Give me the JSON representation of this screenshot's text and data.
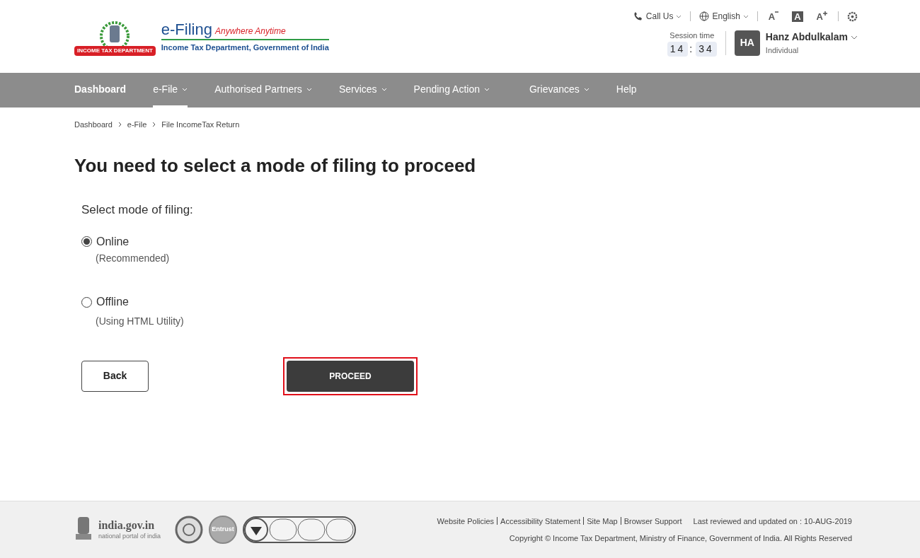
{
  "header": {
    "logo_title": "e-Filing",
    "logo_tagline": "Anywhere Anytime",
    "logo_subtitle": "Income Tax Department, Government of India",
    "emblem_ribbon": "INCOME TAX DEPARTMENT",
    "top_links": [
      {
        "kind": "call",
        "label": "Call Us"
      },
      {
        "kind": "language",
        "label": "English"
      }
    ],
    "text_size_controls": [
      {
        "label": "A",
        "kind": "decrease",
        "selected": false
      },
      {
        "label": "A",
        "kind": "normal",
        "selected": true
      },
      {
        "label": "A",
        "kind": "increase",
        "selected": false
      }
    ],
    "session": {
      "label": "Session time",
      "minutes": "14",
      "separator": ":",
      "seconds": "34"
    },
    "user": {
      "initials": "HA",
      "name": "Hanz Abdulkalam",
      "role": "Individual"
    }
  },
  "nav": [
    {
      "label": "Dashboard",
      "dropdown": false,
      "selected": false
    },
    {
      "label": "e-File",
      "dropdown": true,
      "selected": true
    },
    {
      "label": "Authorised Partners",
      "dropdown": true,
      "selected": false
    },
    {
      "label": "Services",
      "dropdown": true,
      "selected": false
    },
    {
      "label": "Pending Action",
      "dropdown": true,
      "selected": false
    },
    {
      "label": "Grievances",
      "dropdown": true,
      "selected": false
    },
    {
      "label": "Help",
      "dropdown": false,
      "selected": false
    }
  ],
  "breadcrumbs": [
    "Dashboard",
    "e-File",
    "File IncomeTax Return"
  ],
  "heading": "You need to select a mode of filing to proceed",
  "form": {
    "label": "Select mode of filing:",
    "options": [
      {
        "label": "Online",
        "note": "(Recommended)",
        "selected": true
      },
      {
        "label": "Offline",
        "note": "(Using HTML Utility)",
        "selected": false
      }
    ],
    "back_button": "Back",
    "proceed_button": "PROCEED",
    "proceed_highlighted": true
  },
  "footer": {
    "portal_name": "india.gov.in",
    "portal_tagline": "national portal of india",
    "badge_text": "Entrust",
    "links": [
      "Website Policies",
      "Accessibility Statement",
      "Site Map",
      "Browser Support"
    ],
    "last_updated": "Last reviewed and updated on : 10-AUG-2019",
    "copyright": "Copyright © Income Tax Department, Ministry of Finance, Government of India. All Rights Reserved"
  }
}
